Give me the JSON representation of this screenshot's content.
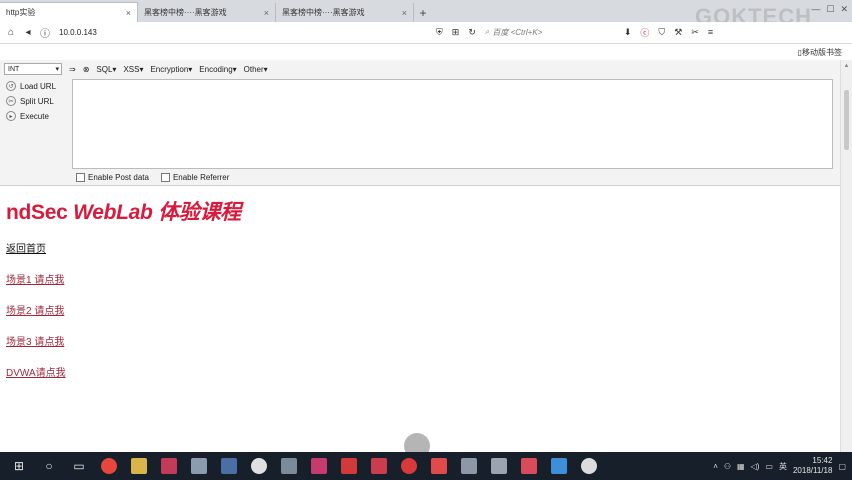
{
  "tabs": [
    {
      "label": "http实验",
      "active": true
    },
    {
      "label": "黑客榜中榜····黑客游戏",
      "active": false
    },
    {
      "label": "黑客榜中榜····黑客游戏",
      "active": false
    }
  ],
  "watermark": "GOKTECH",
  "address": {
    "url": "10.0.0.143",
    "search_placeholder": "百度 <Ctrl+K>"
  },
  "bookmarks": {
    "mobile_label": "移动版书签"
  },
  "hackbar": {
    "select_value": "INT",
    "menu": [
      "SQL▾",
      "XSS▾",
      "Encryption▾",
      "Encoding▾",
      "Other▾"
    ],
    "actions": [
      "Load URL",
      "Split URL",
      "Execute"
    ],
    "textarea_value": "",
    "options": [
      "Enable Post data",
      "Enable Referrer"
    ]
  },
  "page": {
    "title_part1": "ndSec ",
    "title_part2": "WebLab 体验课程",
    "home_link": "返回首页",
    "links": [
      "场景1 请点我",
      "场景2 请点我",
      "场景3 请点我",
      "DVWA请点我"
    ],
    "accent_color": "#d81b3c"
  },
  "taskbar": {
    "time": "15:42",
    "date": "2018/11/18",
    "lang": "英"
  }
}
